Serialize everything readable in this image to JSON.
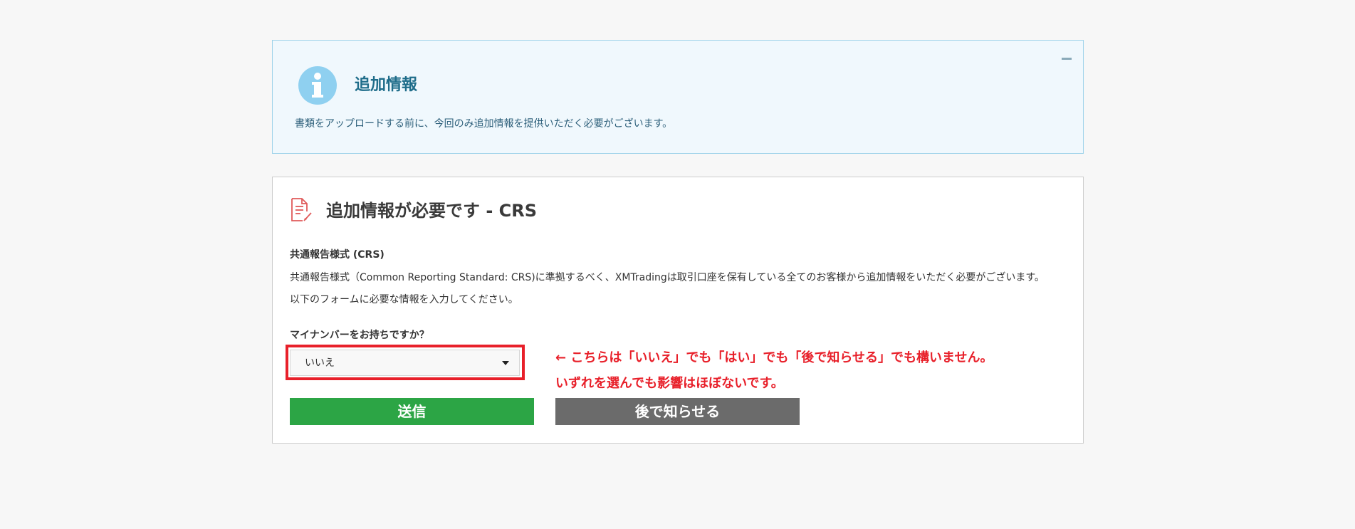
{
  "info_panel": {
    "title": "追加情報",
    "text": "書類をアップロードする前に、今回のみ追加情報を提供いただく必要がございます。",
    "icon": "info-icon",
    "collapse_icon": "minus-icon"
  },
  "card": {
    "icon": "document-edit-icon",
    "title": "追加情報が必要です - CRS",
    "section_heading": "共通報告様式 (CRS)",
    "paragraph1": "共通報告様式（Common Reporting Standard: CRS)に準拠するべく、XMTradingは取引口座を保有している全てのお客様から追加情報をいただく必要がございます。",
    "paragraph2": "以下のフォームに必要な情報を入力してください。",
    "question_label": "マイナンバーをお持ちですか？",
    "select_value": "いいえ",
    "annotation_line1": "← こちらは「いいえ」でも「はい」でも「後で知らせる」でも構いません。",
    "annotation_line2": "いずれを選んでも影響はほぼないです。",
    "submit_label": "送信",
    "later_label": "後で知らせる"
  },
  "colors": {
    "background": "#f7f7f7",
    "info_bg": "#f0f8fd",
    "info_border": "#9fd3ea",
    "info_title": "#1f6d8a",
    "annotation_red": "#e8202a",
    "submit_green": "#2ca545",
    "later_gray": "#6b6b6b",
    "doc_icon_red": "#e05a5a",
    "info_icon_blue": "#8fd0f0"
  }
}
